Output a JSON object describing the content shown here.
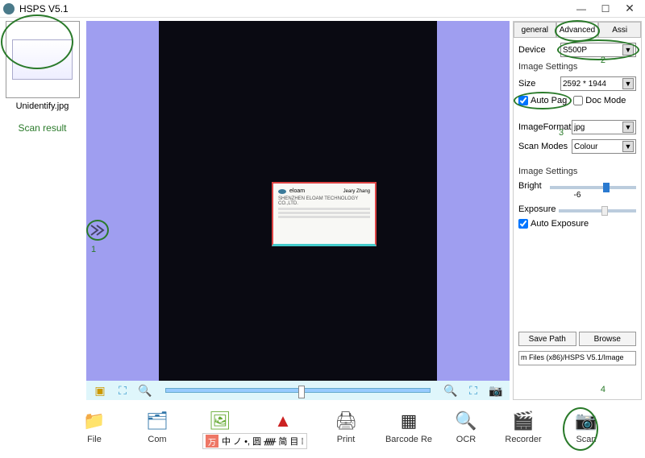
{
  "titlebar": {
    "title": "HSPS V5.1"
  },
  "left": {
    "thumb_label": "Unidentify.jpg",
    "scan_result": "Scan result"
  },
  "center": {
    "card": {
      "brand": "eloam",
      "name": "Jeary Zhang",
      "line1": "SHENZHEN ELOAM TECHNOLOGY CO.,LTD."
    }
  },
  "tabs": {
    "general": "general",
    "advanced": "Advanced",
    "assi": "Assi"
  },
  "panel": {
    "device_label": "Device",
    "device_value": "S500P",
    "image_settings": "Image Settings",
    "size_label": "Size",
    "size_value": "2592 * 1944",
    "auto_page": "Auto Pag",
    "doc_mode": "Doc Mode",
    "image_format_label": "ImageFormat",
    "image_format_value": "jpg",
    "scan_modes_label": "Scan Modes",
    "scan_modes_value": "Colour",
    "image_settings2": "Image Settings",
    "bright_label": "Bright",
    "bright_value": "-6",
    "exposure_label": "Exposure",
    "auto_exposure": "Auto Exposure",
    "save_path": "Save Path",
    "browse": "Browse",
    "path_value": "m Files (x86)/HSPS V5.1/Image"
  },
  "annotations": {
    "n1": "1",
    "n2": "2",
    "n3": "3",
    "n4": "4"
  },
  "bottom": {
    "file": "File",
    "combine": "Com",
    "barcode": "Barcode Re",
    "print": "Print",
    "ocr": "OCR",
    "recorder": "Recorder",
    "scan": "Scan"
  },
  "ime": {
    "items": "中 ノ •, 圆 ᚏ 简 目 ⁞"
  }
}
